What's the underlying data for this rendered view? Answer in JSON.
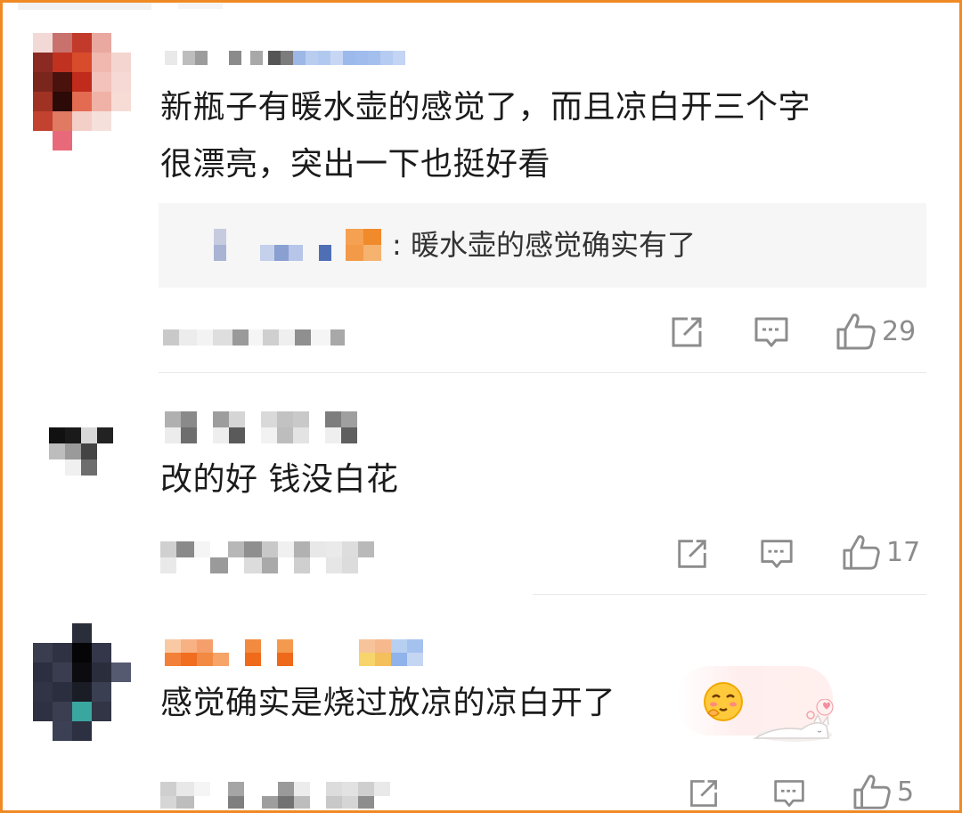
{
  "comments": [
    {
      "text_line1": "新瓶子有暖水壶的感觉了，而且凉白开三个字",
      "text_line2": "很漂亮，突出一下也挺好看",
      "reply": ": 暖水壶的感觉确实有了",
      "likes": "29"
    },
    {
      "text": "改的好 钱没白花",
      "likes": "17"
    },
    {
      "text": "感觉确实是烧过放凉的凉白开了",
      "likes": "5"
    }
  ],
  "icons": {
    "share": "share-icon",
    "reply": "comment-icon",
    "like": "thumbs-up-icon",
    "emoji": "blushing-face-emoji",
    "sticker": "sleeping-cat-sticker"
  },
  "colors": {
    "frame": "#f08a24",
    "icon": "#8c8c8c",
    "text": "#1b1b1b"
  }
}
